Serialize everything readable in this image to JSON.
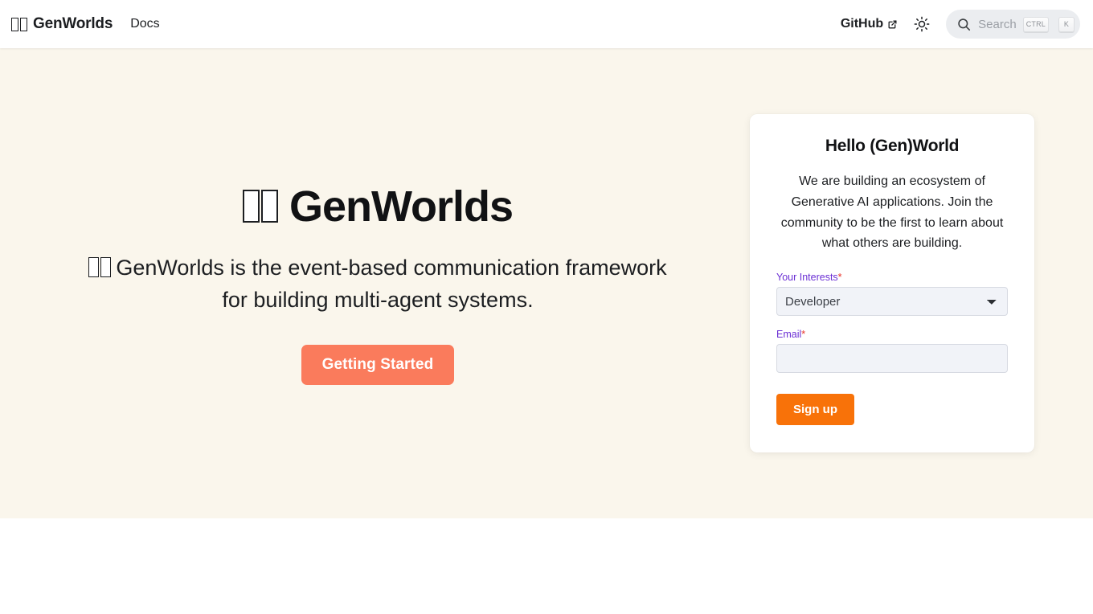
{
  "navbar": {
    "brand_label": "GenWorlds",
    "brand_emoji_icon": "missing-glyph-tofu",
    "docs_label": "Docs",
    "github_label": "GitHub",
    "github_external_icon": "external-link-icon",
    "theme_toggle_icon": "sun-icon",
    "search": {
      "icon": "search-icon",
      "placeholder": "Search",
      "key_hint_1": "CTRL",
      "key_hint_2": "K"
    }
  },
  "hero": {
    "title": "GenWorlds",
    "title_emoji_icon": "missing-glyph-tofu",
    "subtitle": "GenWorlds is the event-based communication framework for building multi-agent systems.",
    "cta_label": "Getting Started"
  },
  "signup_card": {
    "title": "Hello (Gen)World",
    "description": "We are building an ecosystem of Generative AI applications. Join the community to be the first to learn about what others are building.",
    "interests": {
      "label": "Your Interests",
      "required_marker": "*",
      "selected": "Developer",
      "options": [
        "Developer"
      ],
      "chevron_icon": "chevron-down-icon"
    },
    "email": {
      "label": "Email",
      "required_marker": "*",
      "value": "",
      "placeholder": ""
    },
    "submit_label": "Sign up"
  },
  "colors": {
    "hero_background": "#faf6ec",
    "cta_orange": "#fa7b5c",
    "signup_orange": "#f87209",
    "label_purple": "#6b2fd4",
    "required_red": "#e8342a",
    "page_background": "#ffffff"
  }
}
